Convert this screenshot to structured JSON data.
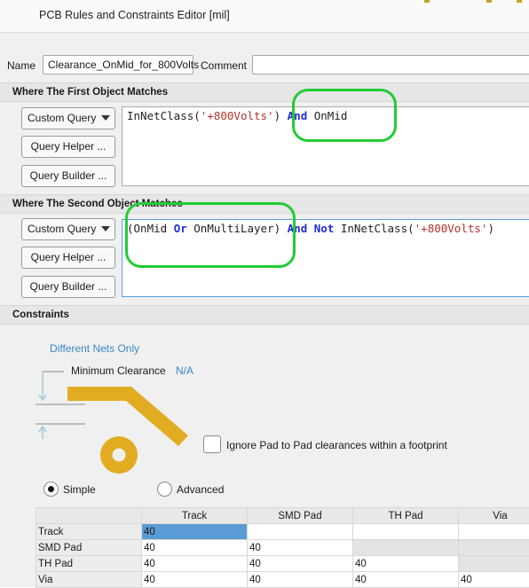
{
  "window": {
    "title": "PCB Rules and Constraints Editor [mil]"
  },
  "rule": {
    "name_label": "Name",
    "name_value": "Clearance_OnMid_for_800Volts",
    "comment_label": "Comment",
    "comment_value": ""
  },
  "first_object": {
    "header": "Where The First Object Matches",
    "query_type": "Custom Query",
    "helper_button": "Query Helper ...",
    "builder_button": "Query Builder ...",
    "query_tokens": [
      {
        "text": "InNetClass(",
        "kind": "tok"
      },
      {
        "text": "'+800Volts'",
        "kind": "str"
      },
      {
        "text": ") ",
        "kind": "tok"
      },
      {
        "text": "And",
        "kind": "kw"
      },
      {
        "text": " OnMid",
        "kind": "tok"
      }
    ]
  },
  "second_object": {
    "header": "Where The Second Object Matches",
    "query_type": "Custom Query",
    "helper_button": "Query Helper ...",
    "builder_button": "Query Builder ...",
    "query_tokens": [
      {
        "text": "(OnMid ",
        "kind": "tok"
      },
      {
        "text": "Or",
        "kind": "kw"
      },
      {
        "text": " OnMultiLayer) ",
        "kind": "tok"
      },
      {
        "text": "And",
        "kind": "kw"
      },
      {
        "text": " ",
        "kind": "tok"
      },
      {
        "text": "Not",
        "kind": "kw"
      },
      {
        "text": " InNetClass(",
        "kind": "tok"
      },
      {
        "text": "'+800Volts'",
        "kind": "str"
      },
      {
        "text": ")",
        "kind": "tok"
      }
    ]
  },
  "constraints": {
    "header": "Constraints",
    "net_scope": "Different Nets Only",
    "min_clearance_label": "Minimum Clearance",
    "min_clearance_value": "N/A",
    "ignore_pad_label": "Ignore Pad to Pad clearances within a footprint",
    "ignore_pad_checked": false,
    "mode_simple": "Simple",
    "mode_advanced": "Advanced",
    "selected_mode": "Simple"
  },
  "clearance_table": {
    "columns": [
      "Track",
      "SMD Pad",
      "TH Pad",
      "Via"
    ],
    "rows": [
      {
        "label": "Track",
        "values": [
          "40",
          "",
          "",
          ""
        ]
      },
      {
        "label": "SMD Pad",
        "values": [
          "40",
          "40",
          "",
          ""
        ]
      },
      {
        "label": "TH Pad",
        "values": [
          "40",
          "40",
          "40",
          ""
        ]
      },
      {
        "label": "Via",
        "values": [
          "40",
          "40",
          "40",
          "40"
        ]
      }
    ]
  },
  "colors": {
    "annotation_highlight": "#22cc33",
    "copper": "#e2ac22",
    "keyword": "#1f2bd8",
    "string": "#b5322e",
    "link": "#3d86c6",
    "selection": "#5b9bd5"
  }
}
